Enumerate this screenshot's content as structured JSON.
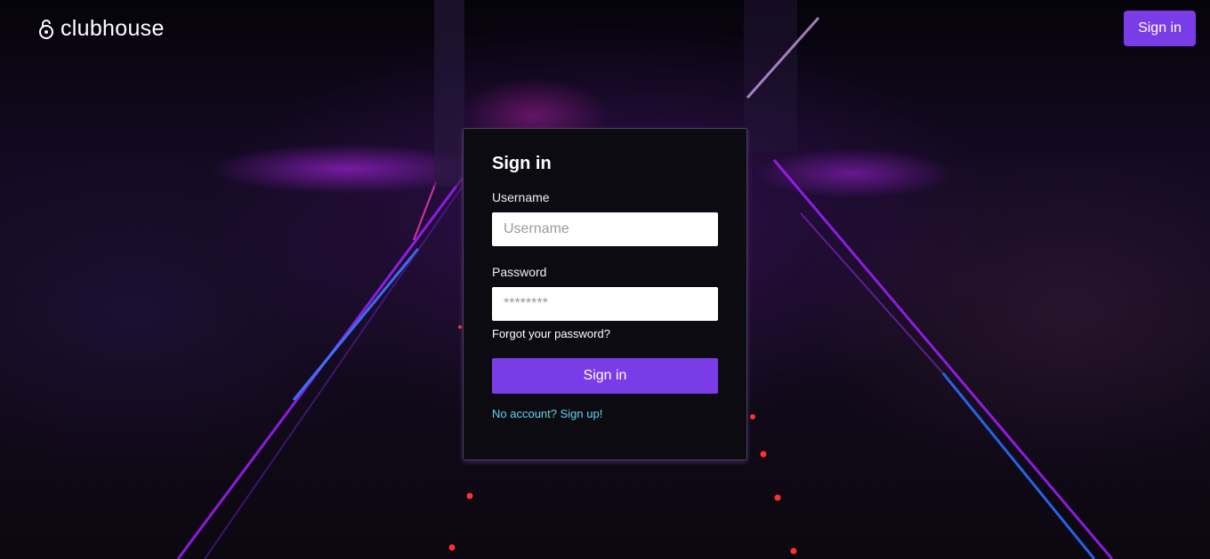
{
  "header": {
    "brand_name": "clubhouse",
    "brand_icon": "padlock-icon",
    "signin_label": "Sign in"
  },
  "login": {
    "title": "Sign in",
    "username_label": "Username",
    "username_placeholder": "Username",
    "username_value": "",
    "password_label": "Password",
    "password_placeholder": "********",
    "password_value": "",
    "forgot_password": "Forgot your password?",
    "submit_label": "Sign in",
    "signup_link": "No account? Sign up!"
  },
  "colors": {
    "accent": "#7a3ce6",
    "link_accent": "#5fd6ea",
    "card_background": "#0d0b12"
  }
}
